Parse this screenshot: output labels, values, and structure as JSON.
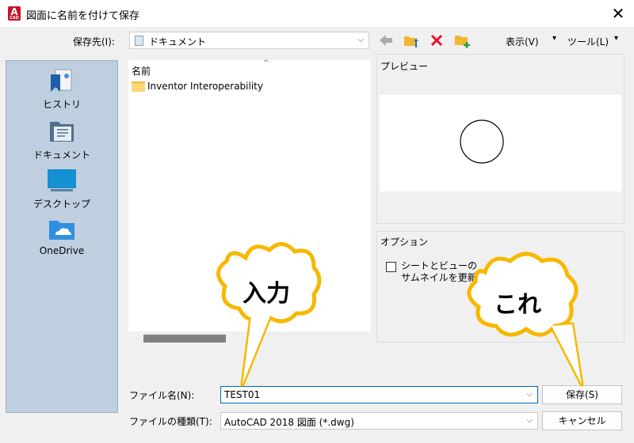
{
  "window": {
    "title": "図面に名前を付けて保存",
    "app_icon_text": "A",
    "app_icon_sub": "CAD",
    "close": "✕"
  },
  "toolbar": {
    "save_in_label": "保存先(I):",
    "save_in_value": "ドキュメント",
    "view_menu": "表示(V)",
    "tools_menu": "ツール(L)",
    "menu_arrow": "▾",
    "icons": [
      "back-arrow-icon",
      "up-folder-icon",
      "delete-icon",
      "new-folder-icon"
    ]
  },
  "places": [
    {
      "label": "ヒストリ",
      "icon": "history-icon"
    },
    {
      "label": "ドキュメント",
      "icon": "documents-icon"
    },
    {
      "label": "デスクトップ",
      "icon": "desktop-icon"
    },
    {
      "label": "OneDrive",
      "icon": "onedrive-icon"
    }
  ],
  "file_list": {
    "column_name": "名前",
    "items": [
      {
        "name": "Inventor Interoperability",
        "type": "folder"
      }
    ]
  },
  "preview": {
    "title": "プレビュー"
  },
  "options": {
    "title": "オプション",
    "thumbnail_label_line1": "シートとビューの",
    "thumbnail_label_line2": "サムネイルを更新",
    "thumbnail_checked": false
  },
  "form": {
    "filename_label": "ファイル名(N):",
    "filename_value": "TEST01",
    "filetype_label": "ファイルの種類(T):",
    "filetype_value": "AutoCAD 2018 図面 (*.dwg)",
    "save_button": "保存(S)",
    "cancel_button": "キャンセル"
  },
  "annotations": {
    "left_bubble": "入力",
    "right_bubble": "これ"
  },
  "colors": {
    "accent": "#0067c0",
    "places_bg": "#bfcfdf",
    "bubble_fill": "#ffffff",
    "bubble_stroke": "#f6b800",
    "app_red": "#c8102e",
    "delete_red": "#e81123",
    "folder_yellow": "#f8d775"
  }
}
